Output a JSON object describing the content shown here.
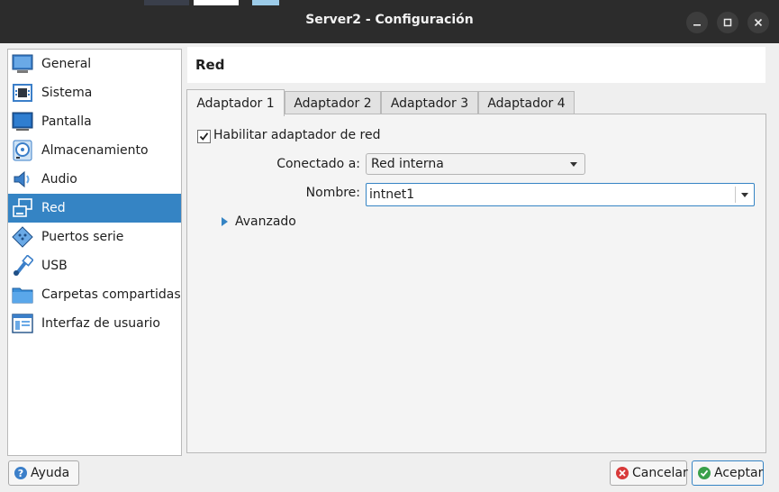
{
  "window": {
    "title": "Server2 - Configuración",
    "controls": {
      "minimize_icon": "minimize-icon",
      "maximize_icon": "maximize-icon",
      "close_icon": "close-icon"
    }
  },
  "sidebar": {
    "items": [
      {
        "label": "General",
        "icon": "general-monitor-icon",
        "selected": false
      },
      {
        "label": "Sistema",
        "icon": "system-chip-icon",
        "selected": false
      },
      {
        "label": "Pantalla",
        "icon": "display-monitor-icon",
        "selected": false
      },
      {
        "label": "Almacenamiento",
        "icon": "storage-disk-icon",
        "selected": false
      },
      {
        "label": "Audio",
        "icon": "audio-speaker-icon",
        "selected": false
      },
      {
        "label": "Red",
        "icon": "network-icon",
        "selected": true
      },
      {
        "label": "Puertos serie",
        "icon": "serial-port-icon",
        "selected": false
      },
      {
        "label": "USB",
        "icon": "usb-icon",
        "selected": false
      },
      {
        "label": "Carpetas compartidas",
        "icon": "shared-folder-icon",
        "selected": false
      },
      {
        "label": "Interfaz de usuario",
        "icon": "user-interface-icon",
        "selected": false
      }
    ]
  },
  "section": {
    "title": "Red"
  },
  "tabs": [
    {
      "label": "Adaptador 1",
      "active": true
    },
    {
      "label": "Adaptador 2",
      "active": false
    },
    {
      "label": "Adaptador 3",
      "active": false
    },
    {
      "label": "Adaptador 4",
      "active": false
    }
  ],
  "adapter": {
    "enable_label": "Habilitar adaptador de red",
    "enabled": true,
    "attached_label": "Conectado a:",
    "attached_value": "Red interna",
    "name_label": "Nombre:",
    "name_value": "intnet1",
    "advanced_label": "Avanzado"
  },
  "buttons": {
    "help": "Ayuda",
    "cancel": "Cancelar",
    "accept": "Aceptar"
  },
  "colors": {
    "accent": "#3584c4",
    "titlebar": "#2c2c2c",
    "dialog_bg": "#efefef"
  }
}
